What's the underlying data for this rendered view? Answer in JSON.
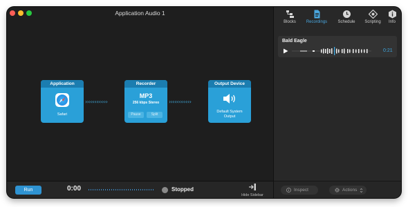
{
  "window": {
    "title": "Application Audio 1"
  },
  "nodes": {
    "application": {
      "header": "Application",
      "label": "Safari",
      "icon": "safari-icon"
    },
    "recorder": {
      "header": "Recorder",
      "format": "MP3",
      "bitrate": "256 kbps Stereo",
      "pause_label": "Pause",
      "split_label": "Split"
    },
    "output": {
      "header": "Output Device",
      "label_line1": "Default System",
      "label_line2": "Output",
      "icon": "speaker-icon"
    }
  },
  "connectors": {
    "glyphs": "››››››››››››"
  },
  "bottom_bar": {
    "run_label": "Run",
    "elapsed": "0:00",
    "status": "Stopped",
    "hide_sidebar_label": "Hide Sidebar"
  },
  "sidebar": {
    "tabs": [
      {
        "label": "Blocks",
        "icon": "blocks-icon",
        "active": false
      },
      {
        "label": "Recordings",
        "icon": "recordings-icon",
        "active": true
      },
      {
        "label": "Schedule",
        "icon": "clock-icon",
        "active": false
      },
      {
        "label": "Scripting",
        "icon": "scripting-icon",
        "active": false
      },
      {
        "label": "Info",
        "icon": "info-icon",
        "active": false
      }
    ],
    "recordings": [
      {
        "name": "Bald Eagle",
        "duration": "0:21"
      }
    ],
    "footer": {
      "inspect_label": "Inspect",
      "actions_label": "Actions"
    }
  },
  "colors": {
    "accent": "#2aa0d8",
    "node_header": "#1b7db0",
    "run": "#2f93d2",
    "active_tab": "#4aa7df"
  }
}
